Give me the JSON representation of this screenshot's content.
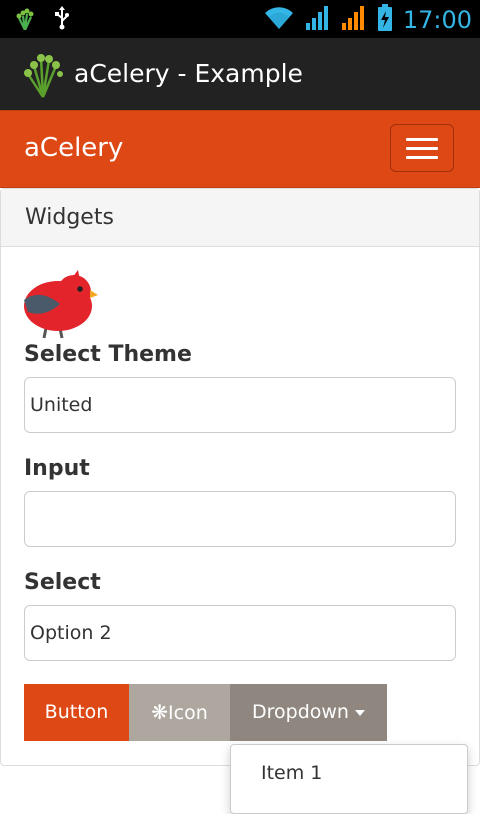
{
  "status_bar": {
    "time": "17:00"
  },
  "action_bar": {
    "title": "aCelery - Example",
    "icon": "celery-icon"
  },
  "navbar": {
    "brand": "aCelery",
    "toggle_icon": "hamburger-icon"
  },
  "panel": {
    "heading": "Widgets"
  },
  "form": {
    "theme_label": "Select Theme",
    "theme_value": "United",
    "input_label": "Input",
    "input_value": "",
    "select_label": "Select",
    "select_value": "Option 2"
  },
  "buttons": {
    "primary_label": "Button",
    "icon_label": "Icon",
    "dropdown_label": "Dropdown"
  },
  "dropdown_menu": {
    "items": [
      "Item 1"
    ]
  },
  "colors": {
    "accent": "#dd4814",
    "status_accent": "#33b5e5",
    "default_button": "#aea79f"
  }
}
